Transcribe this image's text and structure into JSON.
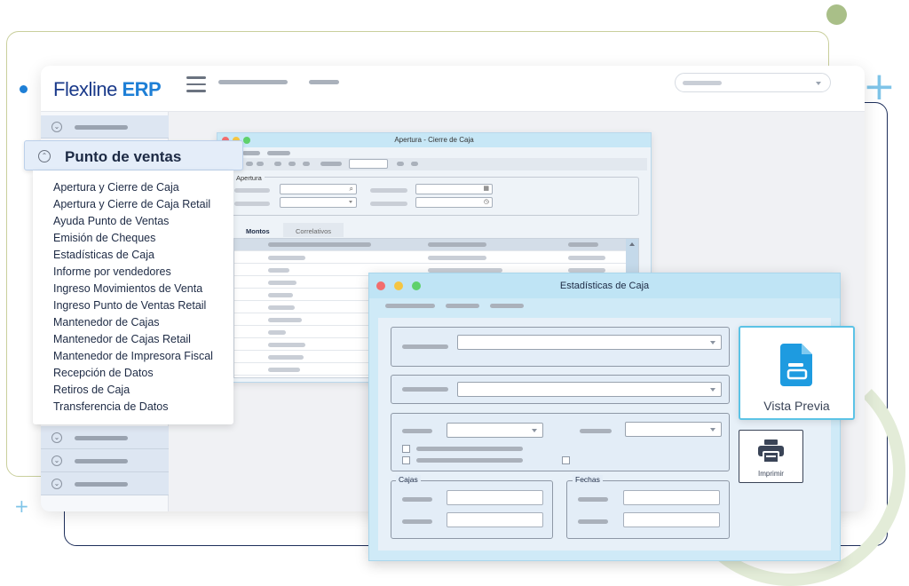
{
  "app": {
    "logo_main": "Flexline",
    "logo_accent": "ERP"
  },
  "menu": {
    "title": "Punto de ventas",
    "items": [
      "Apertura y Cierre de Caja",
      "Apertura y Cierre de Caja Retail",
      "Ayuda Punto de Ventas",
      "Emisión de Cheques",
      "Estadísticas de Caja",
      "Informe por vendedores",
      "Ingreso Movimientos de Venta",
      "Ingreso Punto de Ventas Retail",
      "Mantenedor de Cajas",
      "Mantenedor de Cajas Retail",
      "Mantenedor de Impresora Fiscal",
      "Recepción de Datos",
      "Retiros de Caja",
      "Transferencia de Datos"
    ]
  },
  "window_apertura": {
    "title": "Apertura - Cierre de Caja",
    "group_label": "Apertura",
    "tabs": [
      "Montos",
      "Correlativos"
    ]
  },
  "window_estadisticas": {
    "title": "Estadísticas de Caja",
    "group_cajas": "Cajas",
    "group_fechas": "Fechas"
  },
  "buttons": {
    "preview": "Vista Previa",
    "print": "Imprimir"
  },
  "colors": {
    "brand": "#1a3a8a",
    "accent": "#1e7fd6",
    "preview_icon": "#1e9be0",
    "traffic_red": "#f26d6d",
    "traffic_yellow": "#f5c542",
    "traffic_green": "#5fd16b"
  },
  "icons": {
    "hamburger": "menu-icon",
    "collapse": "chevron-up-circle-icon",
    "expand": "chevron-down-circle-icon",
    "preview": "document-icon",
    "print": "printer-icon",
    "search": "search-icon",
    "calendar": "calendar-icon",
    "clock": "clock-icon"
  }
}
